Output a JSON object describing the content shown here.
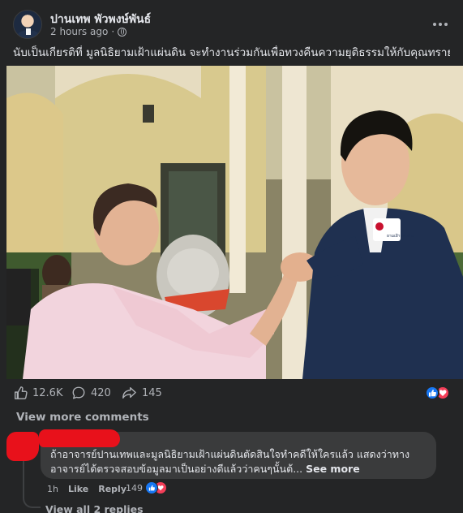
{
  "post": {
    "author": "ปานเทพ พัวพงษ์พันธ์",
    "time": "2 hours ago",
    "separator": "·",
    "privacy_icon": "globe-icon",
    "text": "นับเป็นเกียรติที่ มูลนิธิยามเฝ้าแผ่นดิน จะทำงานร่วมกันเพื่อทวงคืนความยุติธรรมให้กับคุณทราย สมุทรวันนี้",
    "photo_badge_text": "ยามเฝ้าแผ่นดิน"
  },
  "actions": {
    "like_count": "12.6K",
    "comment_count": "420",
    "share_count": "145"
  },
  "comments": {
    "view_more": "View more comments",
    "items": [
      {
        "text": "ถ้าอาจารย์ปานเทพและมูลนิธิยามเฝ้าแผ่นดินตัดสินใจทำคดีให้ใครแล้ว แสดงว่าทางอาจารย์ได้ตรวจสอบข้อมูลมาเป็นอย่างดีแล้วว่าคนๆนั้นต้...",
        "see_more": "See more",
        "time": "1h",
        "like_label": "Like",
        "reply_label": "Reply",
        "reaction_count": "149"
      }
    ],
    "view_replies": "View all 2 replies"
  },
  "colors": {
    "background": "#242526",
    "bubble": "#3a3b3c",
    "text": "#e4e6eb",
    "muted": "#b0b3b8",
    "like_blue": "#1877f2",
    "love_red": "#f33e58",
    "redaction": "#e8111b"
  }
}
